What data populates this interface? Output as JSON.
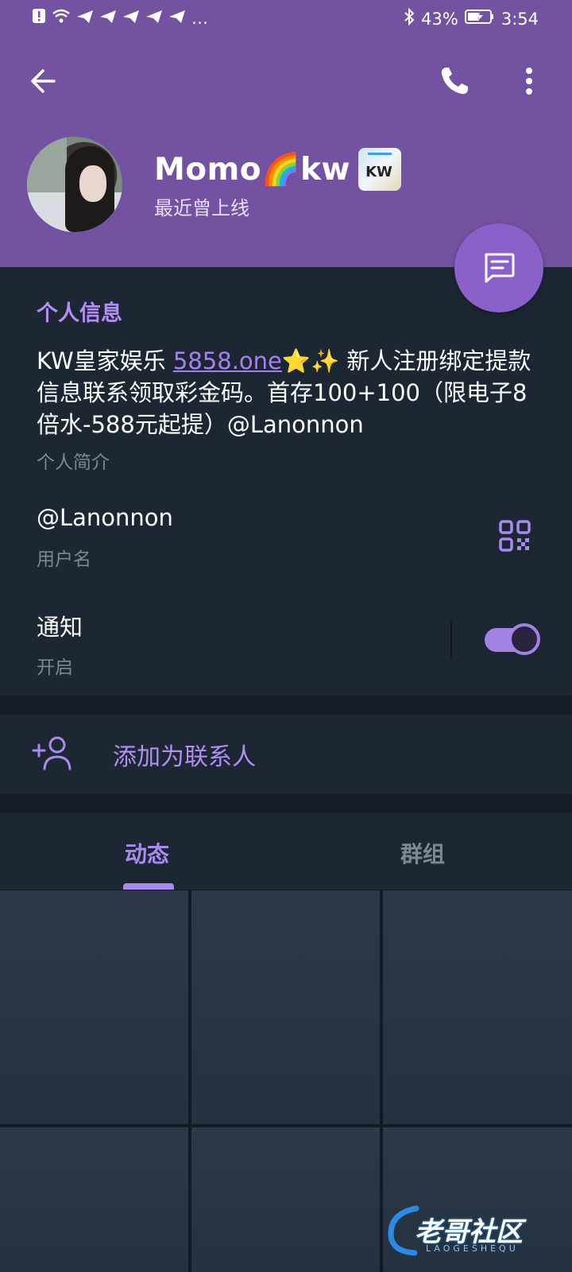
{
  "status_bar": {
    "battery": "43%",
    "time": "3:54",
    "more": "…"
  },
  "profile": {
    "name": "Momo🌈kw",
    "badge_text": "KW",
    "last_seen": "最近曾上线"
  },
  "info": {
    "section_title": "个人信息",
    "bio_prefix": "KW皇家娱乐 ",
    "bio_link": "5858.one",
    "bio_suffix": "⭐✨ 新人注册绑定提款信息联系领取彩金码。首存100+100（限电子8倍水-588元起提）@Lanonnon",
    "bio_label": "个人简介",
    "username": "@Lanonnon",
    "username_label": "用户名",
    "notifications": "通知",
    "notifications_state": "开启",
    "notifications_on": true
  },
  "actions": {
    "add_contact": "添加为联系人"
  },
  "tabs": [
    {
      "label": "动态",
      "active": true
    },
    {
      "label": "群组",
      "active": false
    }
  ],
  "watermark": {
    "text": "老哥社区",
    "sub": "LAOGESHEQU"
  },
  "colors": {
    "header": "#7352a1",
    "accent": "#a98af0",
    "background": "#1d2733"
  },
  "icons": [
    "back-arrow-icon",
    "phone-icon",
    "more-vertical-icon",
    "message-icon",
    "qr-code-icon",
    "add-user-icon"
  ]
}
